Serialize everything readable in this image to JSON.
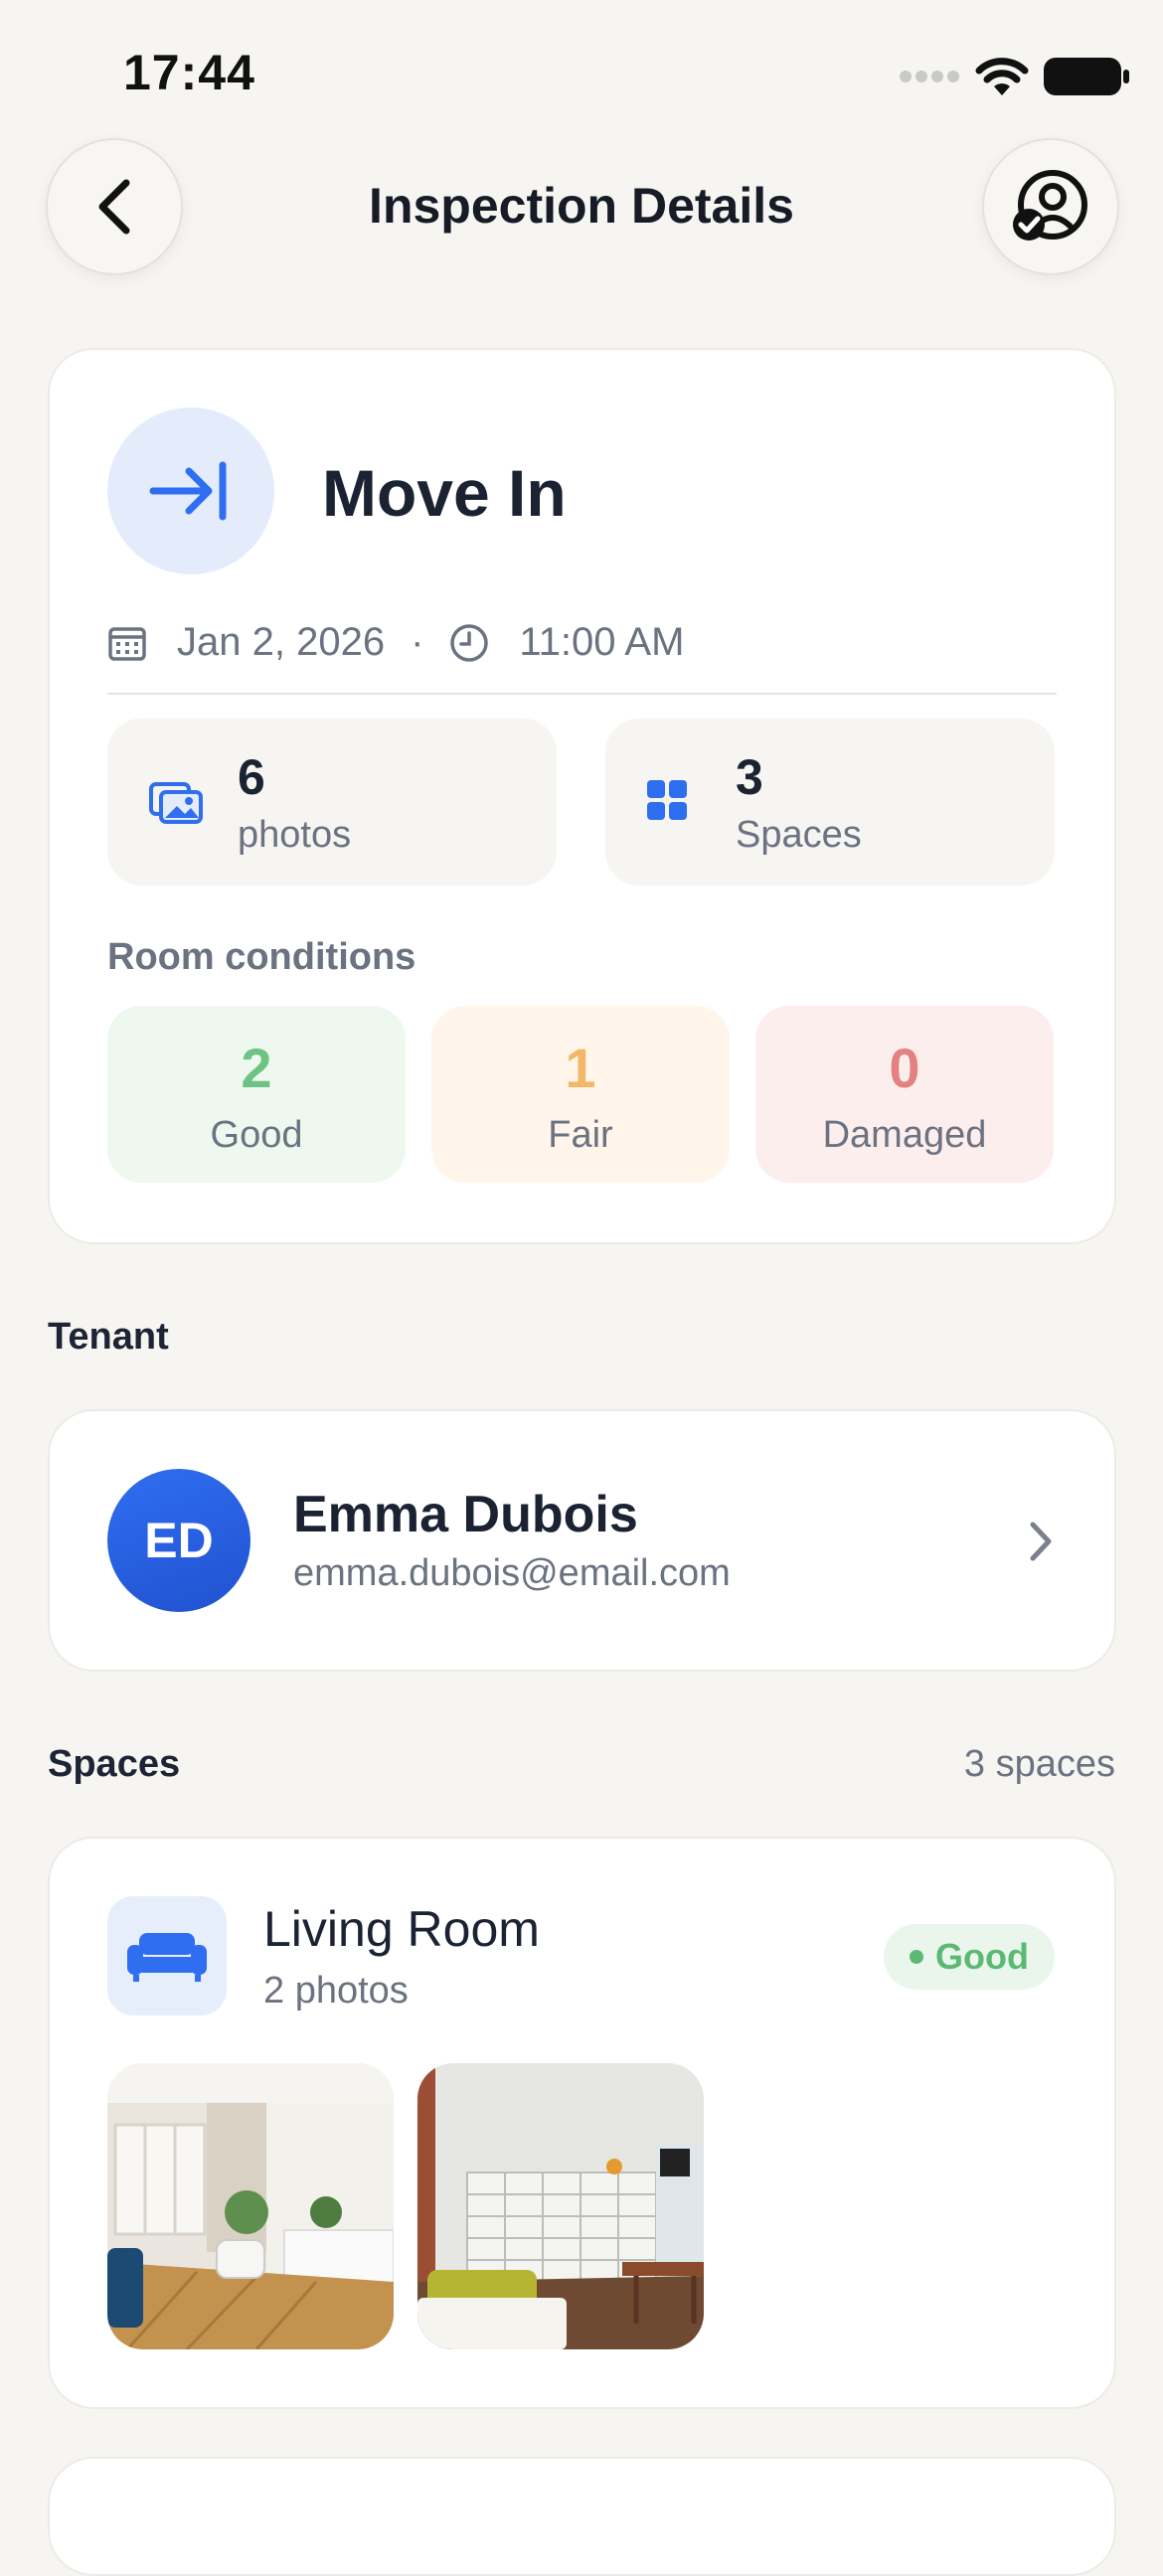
{
  "status_bar": {
    "time": "17:44"
  },
  "header": {
    "title": "Inspection Details"
  },
  "inspection": {
    "type": "Move In",
    "date": "Jan 2, 2026",
    "separator": "·",
    "time": "11:00 AM",
    "photos_count": "6",
    "photos_label": "photos",
    "spaces_count": "3",
    "spaces_label": "Spaces"
  },
  "room_conditions": {
    "label": "Room conditions",
    "items": [
      {
        "count": "2",
        "label": "Good",
        "color": "#6ec383"
      },
      {
        "count": "1",
        "label": "Fair",
        "color": "#f2b867"
      },
      {
        "count": "0",
        "label": "Damaged",
        "color": "#e38181"
      }
    ]
  },
  "tenant": {
    "section_label": "Tenant",
    "initials": "ED",
    "name": "Emma Dubois",
    "email": "emma.dubois@email.com"
  },
  "spaces": {
    "section_label": "Spaces",
    "count_label": "3 spaces",
    "items": [
      {
        "name": "Living Room",
        "photos_label": "2 photos",
        "condition": "Good",
        "icon": "sofa-icon"
      }
    ]
  },
  "colors": {
    "accent": "#2f6ef1",
    "background": "#f6f5f2"
  }
}
